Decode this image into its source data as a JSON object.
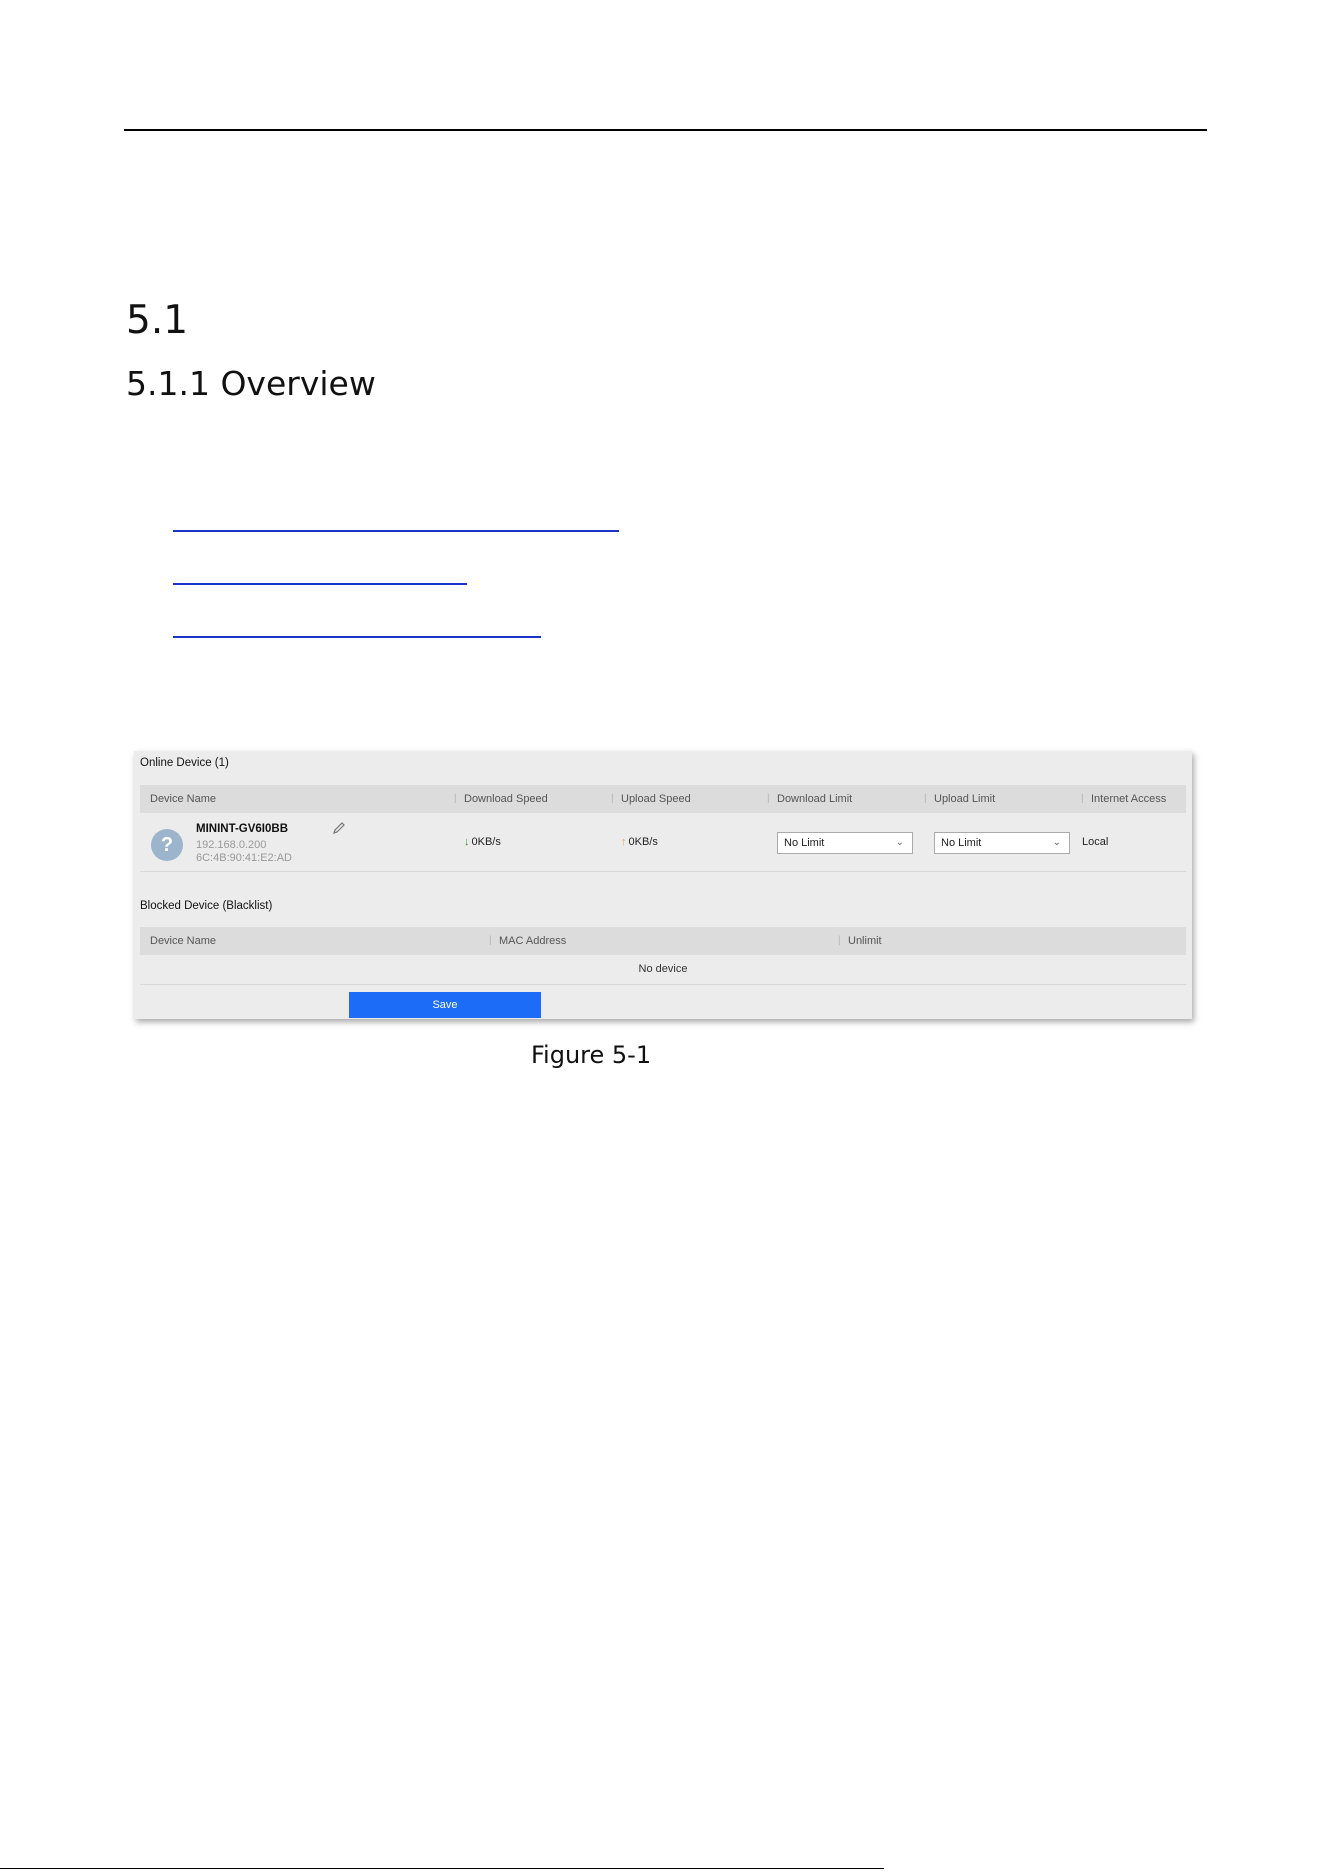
{
  "doc": {
    "section_number": "5.1",
    "subsection_title": "5.1.1 Overview",
    "figure_caption": "Figure 5-1"
  },
  "figure": {
    "online_title": "Online Device (1)",
    "online_columns": [
      "Device Name",
      "Download Speed",
      "Upload Speed",
      "Download Limit",
      "Upload Limit",
      "Internet Access"
    ],
    "device": {
      "avatar_glyph": "?",
      "name": "MININT-GV6I0BB",
      "ip": "192.168.0.200",
      "mac": "6C:4B:90:41:E2:AD",
      "download_speed": "0KB/s",
      "upload_speed": "0KB/s",
      "download_limit": "No Limit",
      "upload_limit": "No Limit",
      "internet_access": "Local"
    },
    "blocked_title": "Blocked Device (Blacklist)",
    "blocked_columns": [
      "Device Name",
      "MAC Address",
      "Unlimit"
    ],
    "blocked_empty": "No device",
    "save_label": "Save"
  },
  "icons": {
    "edit": "pencil-icon",
    "download_arrow": "arrow-down-icon",
    "upload_arrow": "arrow-up-icon",
    "dropdown": "chevron-down-icon"
  },
  "colors": {
    "link": "#1a33c8",
    "save_button": "#1d6cf7",
    "download_arrow": "#2e9b2e",
    "upload_arrow": "#f0a640"
  }
}
